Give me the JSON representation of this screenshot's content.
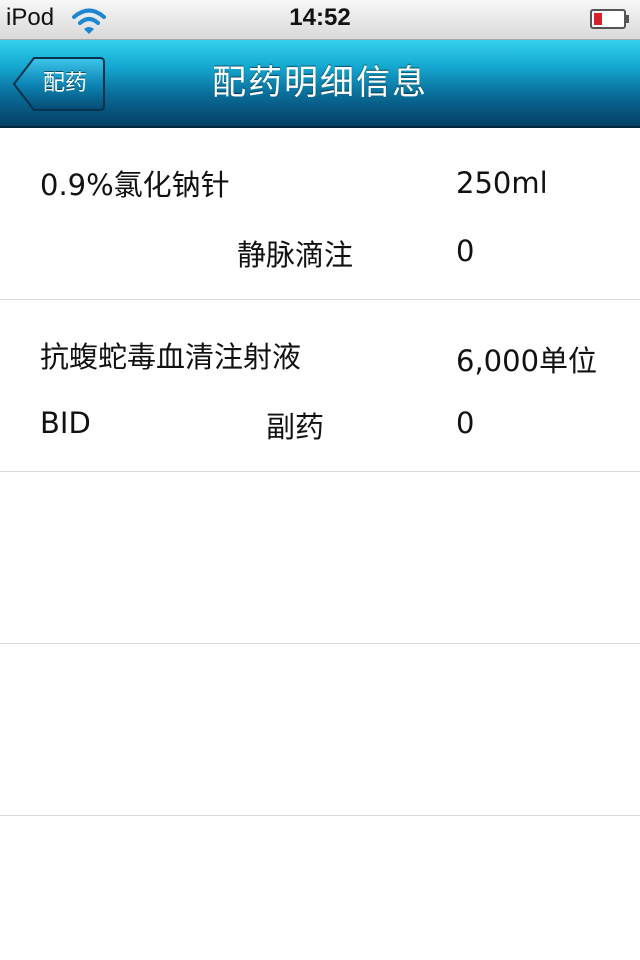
{
  "status_bar": {
    "carrier": "iPod",
    "time": "14:52",
    "wifi_icon": "wifi-icon",
    "battery_icon": "battery-low-icon",
    "battery_color": "#d8202a"
  },
  "nav": {
    "back_label": "配药",
    "title": "配药明细信息",
    "bar_color": "#0a6f9b"
  },
  "items": [
    {
      "name": "0.9%氯化钠针",
      "amount": "250ml",
      "frequency": "",
      "route": "静脉滴注",
      "quantity": "0"
    },
    {
      "name": "抗蝮蛇毒血清注射液",
      "amount": "6,000单位",
      "frequency": "BID",
      "route": "副药",
      "quantity": "0"
    }
  ]
}
